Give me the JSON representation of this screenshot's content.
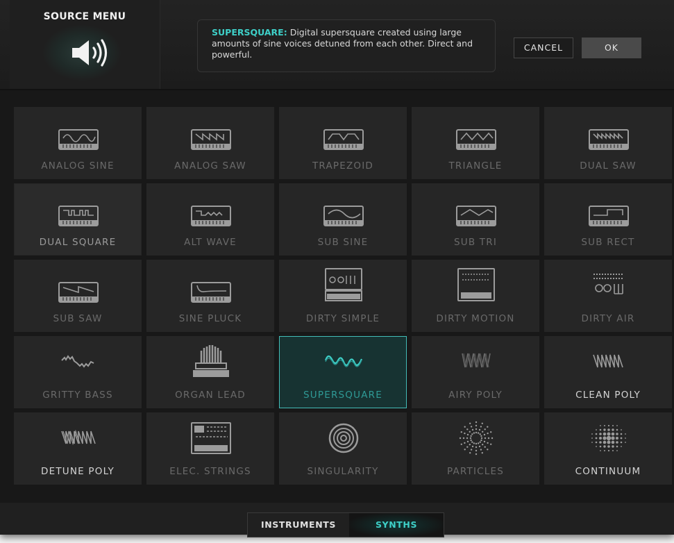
{
  "header": {
    "title": "SOURCE MENU",
    "description": {
      "name": "SUPERSQUARE:",
      "text": "Digital supersquare created using large amounts of sine voices detuned from each other. Direct and powerful."
    },
    "cancel_label": "CANCEL",
    "ok_label": "OK"
  },
  "tiles": [
    {
      "label": "ANALOG SINE",
      "icon": "analog-sine-icon"
    },
    {
      "label": "ANALOG SAW",
      "icon": "analog-saw-icon"
    },
    {
      "label": "TRAPEZOID",
      "icon": "trapezoid-icon"
    },
    {
      "label": "TRIANGLE",
      "icon": "triangle-icon"
    },
    {
      "label": "DUAL SAW",
      "icon": "dual-saw-icon"
    },
    {
      "label": "DUAL SQUARE",
      "icon": "dual-square-icon"
    },
    {
      "label": "ALT WAVE",
      "icon": "alt-wave-icon"
    },
    {
      "label": "SUB SINE",
      "icon": "sub-sine-icon"
    },
    {
      "label": "SUB TRI",
      "icon": "sub-tri-icon"
    },
    {
      "label": "SUB RECT",
      "icon": "sub-rect-icon"
    },
    {
      "label": "SUB SAW",
      "icon": "sub-saw-icon"
    },
    {
      "label": "SINE PLUCK",
      "icon": "sine-pluck-icon"
    },
    {
      "label": "DIRTY SIMPLE",
      "icon": "dirty-simple-icon"
    },
    {
      "label": "DIRTY MOTION",
      "icon": "dirty-motion-icon"
    },
    {
      "label": "DIRTY AIR",
      "icon": "dirty-air-icon"
    },
    {
      "label": "GRITTY BASS",
      "icon": "gritty-bass-icon"
    },
    {
      "label": "ORGAN LEAD",
      "icon": "organ-lead-icon"
    },
    {
      "label": "SUPERSQUARE",
      "icon": "supersquare-icon",
      "selected": true
    },
    {
      "label": "AIRY POLY",
      "icon": "airy-poly-icon"
    },
    {
      "label": "CLEAN POLY",
      "icon": "clean-poly-icon"
    },
    {
      "label": "DETUNE POLY",
      "icon": "detune-poly-icon"
    },
    {
      "label": "ELEC. STRINGS",
      "icon": "elec-strings-icon"
    },
    {
      "label": "SINGULARITY",
      "icon": "singularity-icon"
    },
    {
      "label": "PARTICLES",
      "icon": "particles-icon"
    },
    {
      "label": "CONTINUUM",
      "icon": "continuum-icon"
    }
  ],
  "footer": {
    "instruments_label": "INSTRUMENTS",
    "synths_label": "SYNTHS",
    "active": "SYNTHS"
  },
  "colors": {
    "accent": "#3ed0c8",
    "selected_border": "#43bdb8",
    "panel_bg": "#181818",
    "tile_bg": "#262626"
  }
}
